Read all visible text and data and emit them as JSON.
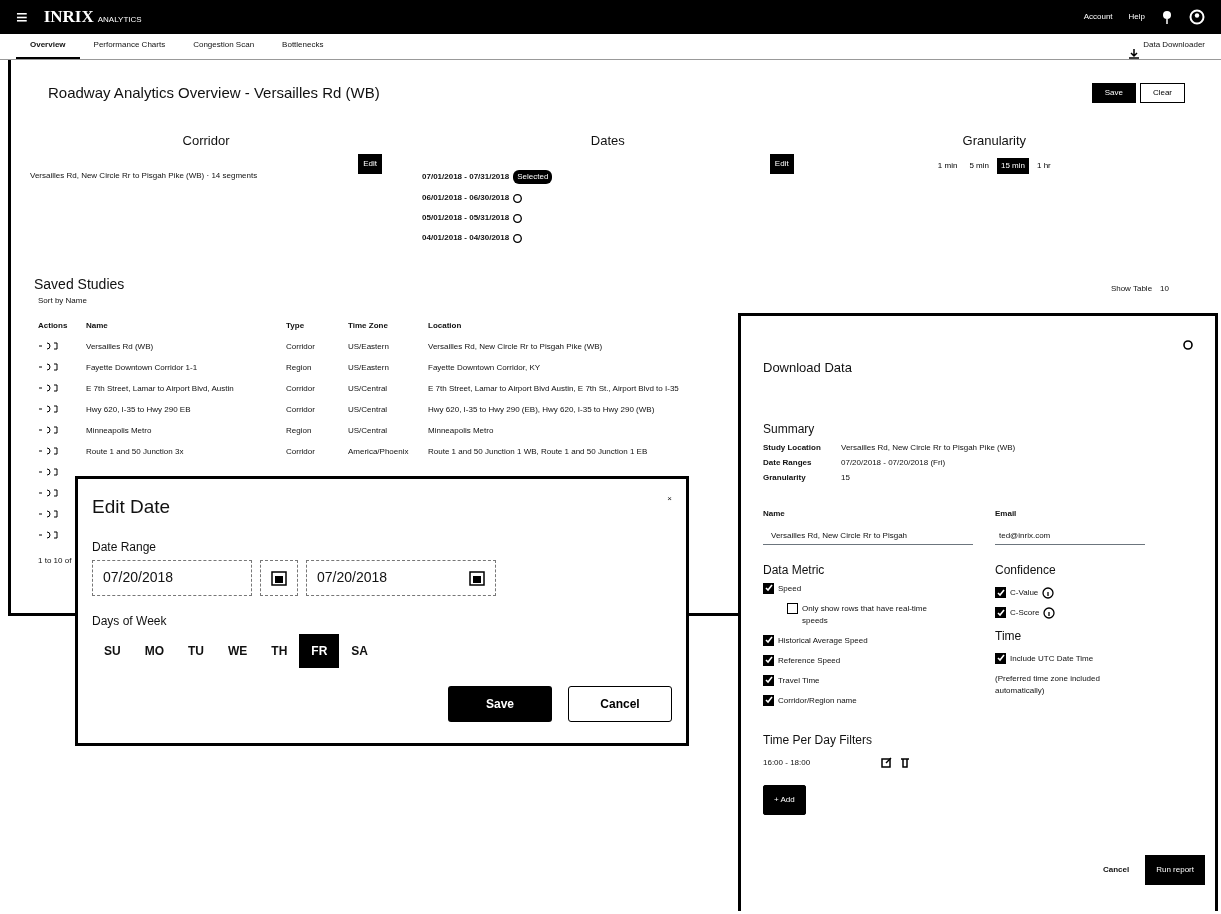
{
  "header": {
    "menu_icon": "≡",
    "logo": "INRIX",
    "logo_sub": "ANALYTICS",
    "user": "Account",
    "help": "Help"
  },
  "tabs": [
    {
      "label": "Overview",
      "selected": true
    },
    {
      "label": "Performance Charts",
      "selected": false
    },
    {
      "label": "Congestion Scan",
      "selected": false
    },
    {
      "label": "Bottlenecks",
      "selected": false
    }
  ],
  "data_downloader": "Data Downloader",
  "page": {
    "title": "Roadway Analytics Overview - Versailles Rd (WB)",
    "buttons": [
      {
        "label": "Save",
        "kind": "primary"
      },
      {
        "label": "Clear",
        "kind": "outline"
      }
    ]
  },
  "corridor": {
    "heading": "Corridor",
    "text": "Versailles Rd, New Circle Rr to Pisgah Pike (WB) · 14 segments",
    "edit": "Edit"
  },
  "dates": {
    "heading": "Dates",
    "edit": "Edit",
    "rows": [
      {
        "range": "07/01/2018 - 07/31/2018",
        "badge": "Selected"
      },
      {
        "range": "06/01/2018 - 06/30/2018"
      },
      {
        "range": "05/01/2018 - 05/31/2018"
      },
      {
        "range": "04/01/2018 - 04/30/2018"
      }
    ]
  },
  "granularity": {
    "heading": "Granularity",
    "options": [
      {
        "label": "1 min",
        "selected": false
      },
      {
        "label": "5 min",
        "selected": false
      },
      {
        "label": "15 min",
        "selected": true
      },
      {
        "label": "1 hr",
        "selected": false
      }
    ]
  },
  "saved_studies": {
    "title": "Saved Studies",
    "sort": "Sort by Name",
    "show": "Show Table",
    "page_size": "10",
    "footer": "1 to 10 of",
    "columns": [
      "Actions",
      "Name",
      "Type",
      "Time Zone",
      "Location"
    ],
    "rows": [
      {
        "kind": "full",
        "name": "Versailles Rd (WB)",
        "type": "Corridor",
        "zone": "US/Eastern",
        "location": "Versailles Rd, New Circle Rr to Pisgah Pike (WB)"
      },
      {
        "kind": "full",
        "name": "Fayette Downtown Corridor 1-1",
        "type": "Region",
        "zone": "US/Eastern",
        "location": "Fayette Downtown Corridor, KY"
      },
      {
        "kind": "full",
        "name": "E 7th Street, Lamar to Airport Blvd, Austin",
        "type": "Corridor",
        "zone": "US/Central",
        "location": "E 7th Street, Lamar to Airport Blvd Austin, E 7th St., Airport Blvd to I-35"
      },
      {
        "kind": "full",
        "name": "Hwy 620, I-35 to Hwy 290 EB",
        "type": "Corridor",
        "zone": "US/Central",
        "location": "Hwy 620, I-35 to Hwy 290 (EB), Hwy 620, I-35 to Hwy 290 (WB)"
      },
      {
        "kind": "full",
        "name": "Minneapolis Metro",
        "type": "Region",
        "zone": "US/Central",
        "location": "Minneapolis Metro"
      },
      {
        "kind": "full",
        "name": "Route 1 and 50 Junction 3x",
        "type": "Corridor",
        "zone": "America/Phoenix",
        "location": "Route 1 and 50 Junction 1 WB, Route 1 and 50 Junction 1 EB"
      },
      {
        "kind": "covered"
      },
      {
        "kind": "covered"
      },
      {
        "kind": "covered"
      },
      {
        "kind": "covered"
      }
    ]
  },
  "edit_date": {
    "title": "Edit Date",
    "close": "×",
    "range_label": "Date Range",
    "from": "07/20/2018",
    "to": "07/20/2018",
    "days_label": "Days of Week",
    "days": [
      {
        "label": "SU",
        "selected": false
      },
      {
        "label": "MO",
        "selected": false
      },
      {
        "label": "TU",
        "selected": false
      },
      {
        "label": "WE",
        "selected": false
      },
      {
        "label": "TH",
        "selected": false
      },
      {
        "label": "FR",
        "selected": true
      },
      {
        "label": "SA",
        "selected": false
      }
    ],
    "save": "Save",
    "cancel": "Cancel"
  },
  "download": {
    "title": "Download Data",
    "summary_heading": "Summary",
    "summary": [
      {
        "label": "Study Location",
        "value": "Versailles Rd, New Circle Rr to Pisgah Pike (WB)"
      },
      {
        "label": "Date Ranges",
        "value": "07/20/2018 - 07/20/2018 (Fri)"
      },
      {
        "label": "Granularity",
        "value": "15"
      }
    ],
    "name_label": "Name",
    "name_value": "Versailles Rd, New Circle Rr to Pisgah",
    "email_label": "Email",
    "email_value": "ted@inrix.com",
    "metric_heading": "Data Metric",
    "metrics": [
      {
        "label": "Speed",
        "checked": true,
        "children": [
          {
            "label": "Only show rows that have real-time speeds",
            "checked": false
          }
        ]
      },
      {
        "label": "Historical Average Speed",
        "checked": true
      },
      {
        "label": "Reference Speed",
        "checked": true
      },
      {
        "label": "Travel Time",
        "checked": true
      },
      {
        "label": "Corridor/Region name",
        "checked": true
      }
    ],
    "confidence_heading": "Confidence",
    "confidence": [
      {
        "label": "C-Value",
        "checked": true
      },
      {
        "label": "C-Score",
        "checked": true
      }
    ],
    "time_heading": "Time",
    "time_options": [
      {
        "label": "Include UTC Date Time",
        "checked": true
      }
    ],
    "time_note": "(Preferred time zone included automatically)",
    "filters_heading": "Time Per Day Filters",
    "filters": [
      "16:00 - 18:00"
    ],
    "add": "+ Add",
    "cancel": "Cancel",
    "run": "Run report"
  }
}
